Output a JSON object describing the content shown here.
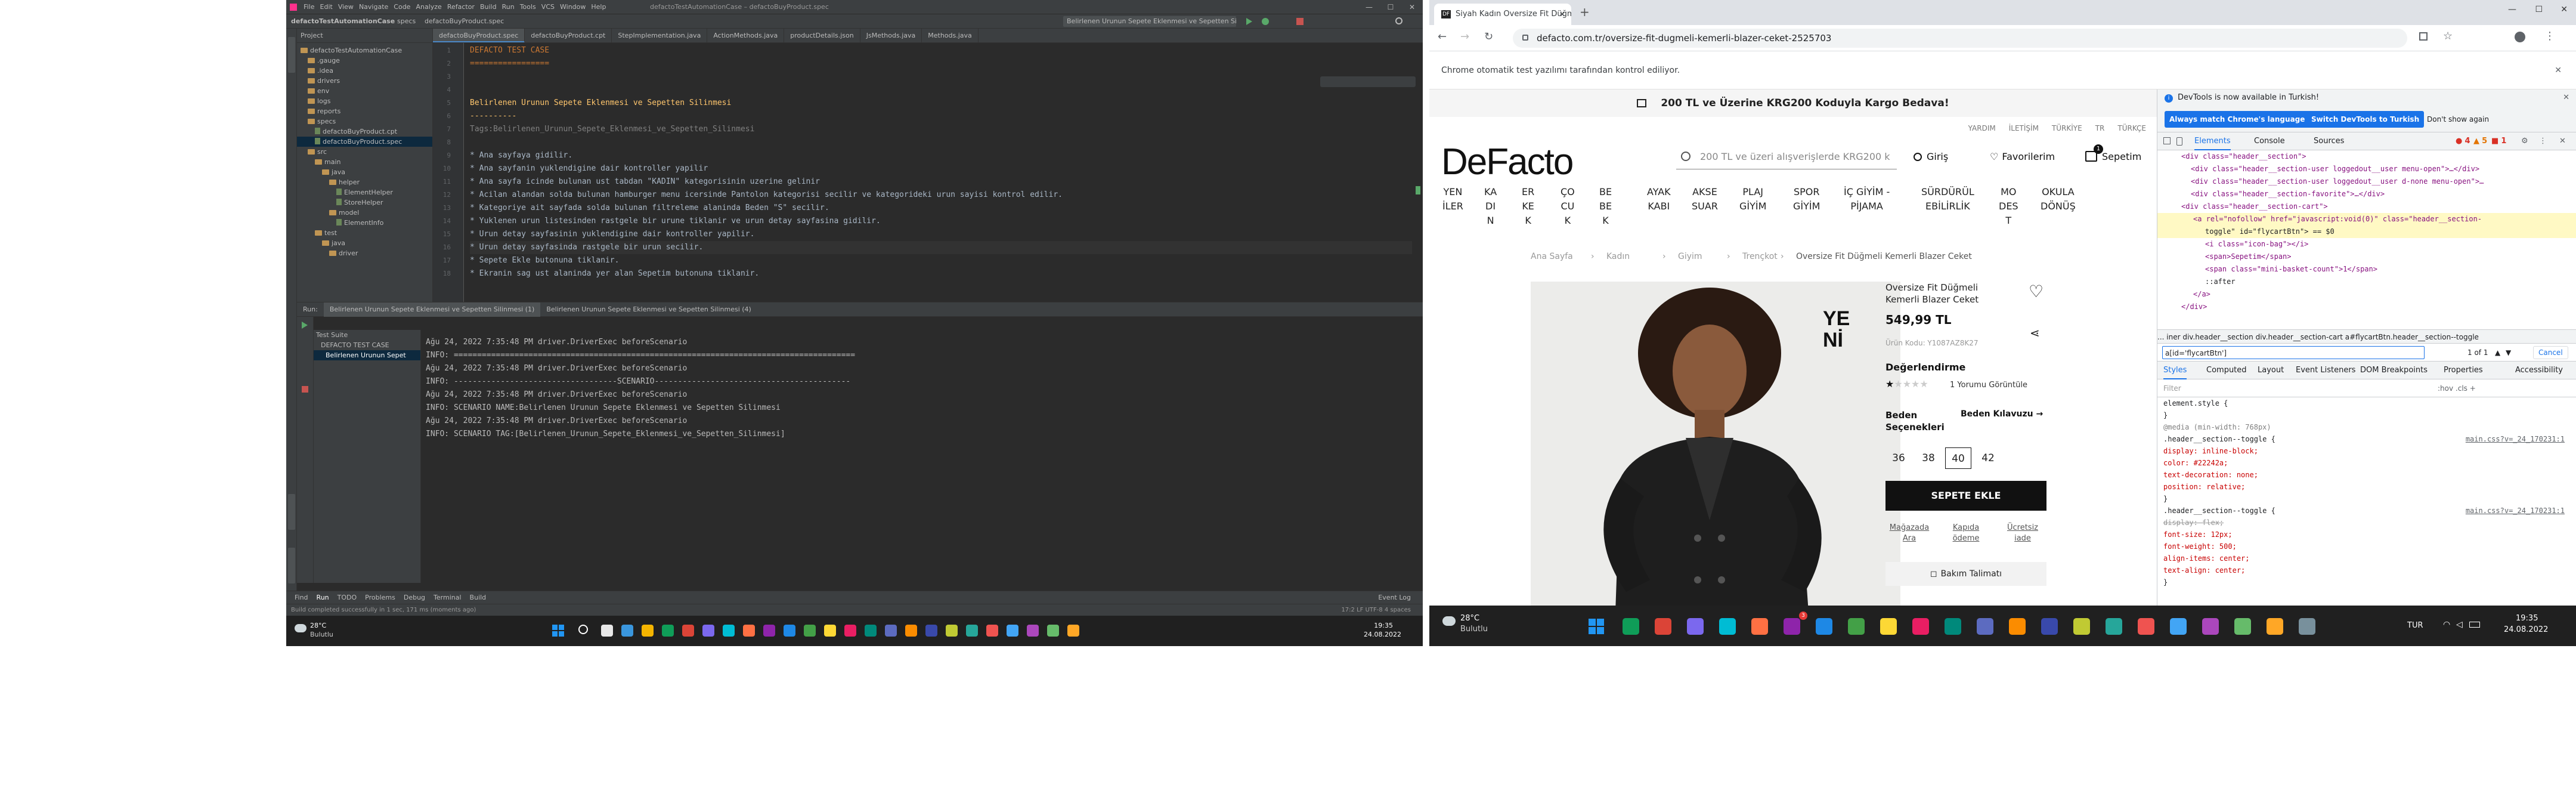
{
  "ide": {
    "title": "defactoTestAutomationCase – defactoBuyProduct.spec",
    "menu": [
      "File",
      "Edit",
      "View",
      "Navigate",
      "Code",
      "Analyze",
      "Refactor",
      "Build",
      "Run",
      "Tools",
      "VCS",
      "Window",
      "Help"
    ],
    "nav": {
      "project": "defactoTestAutomationCase",
      "specs": "specs",
      "file": "defactoBuyProduct.spec",
      "run_config": "Belirlenen Urunun Sepete Eklenmesi ve Sepetten Silinmesi (1)"
    },
    "tabs": [
      "defactoBuyProduct.spec",
      "defactoBuyProduct.cpt",
      "StepImplementation.java",
      "ActionMethods.java",
      "productDetails.json",
      "JsMethods.java",
      "Methods.java"
    ],
    "project_label": "Project",
    "tree": [
      {
        "name": "defactoTestAutomationCase",
        "type": "folder",
        "indent": 0
      },
      {
        "name": ".gauge",
        "type": "folder",
        "indent": 1
      },
      {
        "name": ".idea",
        "type": "folder",
        "indent": 1
      },
      {
        "name": "drivers",
        "type": "folder",
        "indent": 1
      },
      {
        "name": "env",
        "type": "folder",
        "indent": 1
      },
      {
        "name": "logs",
        "type": "folder",
        "indent": 1
      },
      {
        "name": "reports",
        "type": "folder",
        "indent": 1
      },
      {
        "name": "specs",
        "type": "folder",
        "indent": 1
      },
      {
        "name": "defactoBuyProduct.cpt",
        "type": "file",
        "indent": 2
      },
      {
        "name": "defactoBuyProduct.spec",
        "type": "file",
        "indent": 2
      },
      {
        "name": "src",
        "type": "folder",
        "indent": 1
      },
      {
        "name": "main",
        "type": "folder",
        "indent": 2
      },
      {
        "name": "java",
        "type": "folder",
        "indent": 3
      },
      {
        "name": "helper",
        "type": "folder",
        "indent": 4
      },
      {
        "name": "ElementHelper",
        "type": "file",
        "indent": 5
      },
      {
        "name": "StoreHelper",
        "type": "file",
        "indent": 5
      },
      {
        "name": "model",
        "type": "folder",
        "indent": 4
      },
      {
        "name": "ElementInfo",
        "type": "file",
        "indent": 5
      },
      {
        "name": "test",
        "type": "folder",
        "indent": 2
      },
      {
        "name": "java",
        "type": "folder",
        "indent": 3
      },
      {
        "name": "driver",
        "type": "folder",
        "indent": 4
      }
    ],
    "code": [
      {
        "ln": "1",
        "text": "DEFACTO TEST CASE",
        "color": "#cc7832"
      },
      {
        "ln": "2",
        "text": "=================",
        "color": "#cc7832"
      },
      {
        "ln": "3",
        "text": "",
        "color": "#bbbbbb"
      },
      {
        "ln": "4",
        "text": "",
        "color": "#bbbbbb"
      },
      {
        "ln": "5",
        "text": "Belirlenen Urunun Sepete Eklenmesi ve Sepetten Silinmesi",
        "color": "#ffc66d"
      },
      {
        "ln": "6",
        "text": "----------",
        "color": "#ffc66d"
      },
      {
        "ln": "7",
        "text": "Tags:Belirlenen_Urunun_Sepete_Eklenmesi_ve_Sepetten_Silinmesi",
        "color": "#808080"
      },
      {
        "ln": "8",
        "text": "",
        "color": "#bbbbbb"
      },
      {
        "ln": "9",
        "text": "* Ana sayfaya gidilir.",
        "color": "#a9b7c6"
      },
      {
        "ln": "10",
        "text": "* Ana sayfanin yuklendigine dair kontroller yapilir",
        "color": "#a9b7c6"
      },
      {
        "ln": "11",
        "text": "* Ana sayfa icinde bulunan ust tabdan \"KADIN\" kategorisinin uzerine gelinir",
        "color": "#a9b7c6"
      },
      {
        "ln": "12",
        "text": "* Acilan alandan solda bulunan hamburger menu icersinde Pantolon kategorisi secilir ve kategorideki urun sayisi kontrol edilir.",
        "color": "#a9b7c6"
      },
      {
        "ln": "13",
        "text": "* Kategoriye ait sayfada solda bulunan filtreleme alaninda Beden \"S\" secilir.",
        "color": "#a9b7c6"
      },
      {
        "ln": "14",
        "text": "* Yuklenen urun listesinden rastgele bir urune tiklanir ve urun detay sayfasina gidilir.",
        "color": "#a9b7c6"
      },
      {
        "ln": "15",
        "text": "* Urun detay sayfasinin yuklendigine dair kontroller yapilir.",
        "color": "#a9b7c6"
      },
      {
        "ln": "16",
        "text": "* Urun detay sayfasinda rastgele bir urun secilir.",
        "color": "#a9b7c6"
      },
      {
        "ln": "17",
        "text": "* Sepete Ekle butonuna tiklanir.",
        "color": "#a9b7c6"
      },
      {
        "ln": "18",
        "text": "* Ekranin sag ust alaninda yer alan Sepetim butonuna tiklanir.",
        "color": "#a9b7c6"
      }
    ],
    "run_tabs": [
      "Run:",
      "Belirlenen Urunun Sepete Eklenmesi ve Sepetten Silinmesi (1)",
      "Belirlenen Urunun Sepete Eklenmesi ve Sepetten Silinmesi (4)"
    ],
    "run_tree": [
      "Test Suite",
      "DEFACTO TEST CASE",
      "Belirlenen Urunun Sepet"
    ],
    "console": [
      "Ağu 24, 2022 7:35:48 PM driver.DriverExec beforeScenario",
      "INFO: ======================================================================================",
      "Ağu 24, 2022 7:35:48 PM driver.DriverExec beforeScenario",
      "INFO: -----------------------------------SCENARIO------------------------------------------",
      "Ağu 24, 2022 7:35:48 PM driver.DriverExec beforeScenario",
      "INFO: SCENARIO NAME:Belirlenen Urunun Sepete Eklenmesi ve Sepetten Silinmesi",
      "Ağu 24, 2022 7:35:48 PM driver.DriverExec beforeScenario",
      "INFO: SCENARIO TAG:[Belirlenen_Urunun_Sepete_Eklenmesi_ve_Sepetten_Silinmesi]"
    ],
    "bottom_tabs": [
      "Find",
      "Run",
      "TODO",
      "Problems",
      "Debug",
      "Terminal",
      "Build"
    ],
    "event_log": "Event Log",
    "status_left": "Build completed successfully in 1 sec, 171 ms (moments ago)",
    "status_right": "17:2   LF   UTF-8   4 spaces"
  },
  "taskbar_left": {
    "temp": "28°C",
    "weather": "Bulutlu",
    "time": "19:35",
    "date": "24.08.2022"
  },
  "chrome": {
    "tab_title": "Siyah Kadın Oversize Fit Düğmeli",
    "url": "defacto.com.tr/oversize-fit-dugmeli-kemerli-blazer-ceket-2525703",
    "infobar": "Chrome otomatik test yazılımı tarafından kontrol ediliyor."
  },
  "site": {
    "promo": "200 TL ve Üzerine KRG200 Koduyla Kargo Bedava!",
    "topmini": [
      "YARDIM",
      "İLETİŞİM",
      "TÜRKİYE",
      "TR",
      "TÜRKÇE"
    ],
    "logo": "DeFacto",
    "search_placeholder": "200 TL ve üzeri alışverişlerde KRG200 k",
    "login": "Giriş",
    "favorites": "Favorilerim",
    "cart": "Sepetim",
    "cart_count": "1",
    "categories": [
      [
        "YEN",
        "İLER"
      ],
      [
        "KA",
        "DI",
        "N"
      ],
      [
        "ER",
        "KE",
        "K"
      ],
      [
        "ÇO",
        "CU",
        "K"
      ],
      [
        "BE",
        "BE",
        "K"
      ],
      [
        "AYAK",
        "KABI"
      ],
      [
        "AKSE",
        "SUAR"
      ],
      [
        "PLAJ",
        "GİYİM"
      ],
      [
        "SPOR",
        "GİYİM"
      ],
      [
        "İÇ GİYİM -",
        "PİJAMA"
      ],
      [
        "SÜRDÜRÜL",
        "EBİLİRLİK"
      ],
      [
        "MO",
        "DES",
        "T"
      ],
      [
        "OKULA",
        "DÖNÜŞ"
      ]
    ],
    "breadcrumb": [
      "Ana Sayfa",
      "Kadın",
      "Giyim",
      "Trençkot",
      "Oversize Fit Düğmeli Kemerli Blazer Ceket"
    ],
    "product_name": "Oversize Fit Düğmeli Kemerli Blazer Ceket",
    "price": "549,99 TL",
    "code": "Ürün Kodu: Y1087AZ8K27",
    "badge": "YENİ",
    "rating_title": "Değerlendirme",
    "rating_stars": 1,
    "reviews": "1 Yorumu Görüntüle",
    "size_title": "Beden Seçenekleri",
    "size_guide": "Beden Kılavuzu",
    "sizes": [
      "36",
      "38",
      "40",
      "42"
    ],
    "selected_size": "40",
    "add_to_cart": "SEPETE EKLE",
    "links": [
      [
        "Mağazada",
        "Ara"
      ],
      [
        "Kapıda",
        "ödeme"
      ],
      [
        "Ücretsiz",
        "iade"
      ]
    ],
    "care": "Bakım Talimatı"
  },
  "devtools": {
    "banner": "DevTools is now available in Turkish!",
    "btn_match": "Always match Chrome's language",
    "btn_switch": "Switch DevTools to Turkish",
    "btn_dont": "Don't show again",
    "tabs": [
      "Elements",
      "Console",
      "Sources"
    ],
    "counts": {
      "errors": "4",
      "warnings": "5",
      "info": "1"
    },
    "dom": [
      "<div class=\"header__section\">",
      "<div class=\"header__section-user loggedout__user menu-open\">…</div>",
      "<div class=\"header__section-user loggedout__user d-none menu-open\">…",
      "<div class=\"header__section-favorite\">…</div>",
      "<div class=\"header__section-cart\">",
      "<a rel=\"nofollow\" href=\"javascript:void(0)\" class=\"header__section-",
      "toggle\" id=\"flycartBtn\"> == $0",
      "<i class=\"icon-bag\"></i>",
      "<span>Sepetim</span>",
      "<span class=\"mini-basket-count\">1</span>",
      "::after",
      "</a>",
      "</div>"
    ],
    "crumb": "...  iner  div.header__section  div.header__section-cart  a#flycartBtn.header__section--toggle",
    "find_value": "a[id='flycartBtn']",
    "find_count": "1 of 1",
    "cancel": "Cancel",
    "subtabs": [
      "Styles",
      "Computed",
      "Layout",
      "Event Listeners",
      "DOM Breakpoints",
      "Properties",
      "Accessibility"
    ],
    "filter": "Filter",
    "filter_right": ":hov  .cls  +",
    "styles": [
      {
        "t": "element.style {",
        "c": "#202124"
      },
      {
        "t": "}",
        "c": "#202124"
      },
      {
        "t": "@media (min-width: 768px)",
        "c": "#808080"
      },
      {
        "t": ".header__section--toggle {",
        "c": "#202124"
      },
      {
        "t": "  display: inline-block;",
        "c": "#c80000"
      },
      {
        "t": "  color: #22242a;",
        "c": "#c80000"
      },
      {
        "t": "  text-decoration: none;",
        "c": "#c80000"
      },
      {
        "t": "  position: relative;",
        "c": "#c80000"
      },
      {
        "t": "}",
        "c": "#202124"
      },
      {
        "t": ".header__section--toggle {",
        "c": "#202124"
      },
      {
        "t": "  display: flex;",
        "c": "#999999"
      },
      {
        "t": "  font-size: 12px;",
        "c": "#c80000"
      },
      {
        "t": "  font-weight: 500;",
        "c": "#c80000"
      },
      {
        "t": "  align-items: center;",
        "c": "#c80000"
      },
      {
        "t": "  text-align: center;",
        "c": "#c80000"
      },
      {
        "t": "}",
        "c": "#202124"
      }
    ],
    "style_src": "main.css?v=_24_170231:1"
  },
  "taskbar_right": {
    "temp": "28°C",
    "weather": "Bulutlu",
    "lang": "TUR",
    "time": "19:35",
    "date": "24.08.2022",
    "badge": "3"
  }
}
